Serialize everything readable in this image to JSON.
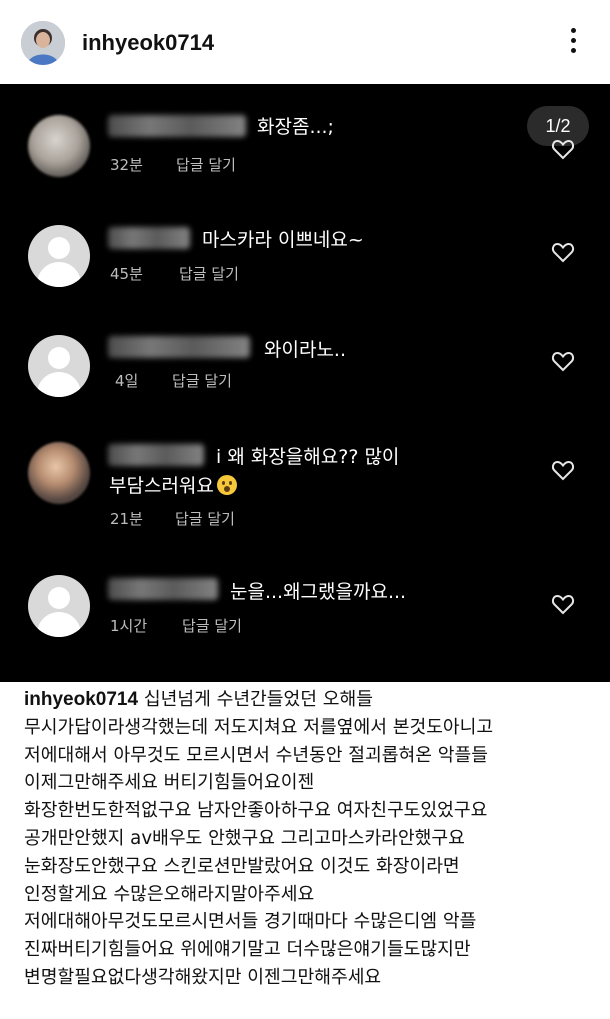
{
  "header": {
    "username": "inhyeok0714",
    "more_icon": "more-vertical-icon"
  },
  "media": {
    "counter": "1/2",
    "comments": [
      {
        "text": "화장좀...;",
        "time": "32분",
        "reply": "답글 달기",
        "avatar": "blurred-photo"
      },
      {
        "text": "마스카라 이쁘네요~",
        "time": "45분",
        "reply": "답글 달기",
        "avatar": "default"
      },
      {
        "text": "와이라노..",
        "time": "4일",
        "reply": "답글 달기",
        "avatar": "default"
      },
      {
        "text_line1": "i 왜 화장을해요?? 많이",
        "text_line2": "부담스러워요",
        "time": "21분",
        "reply": "답글 달기",
        "avatar": "blurred-photo",
        "emoji": "astonished-face"
      },
      {
        "text": "눈을...왜그랬을까요...",
        "time": "1시간",
        "reply": "답글 달기",
        "avatar": "default"
      }
    ]
  },
  "caption": {
    "username": "inhyeok0714",
    "lines": [
      "십년넘게 수년간들었던 오해들",
      "무시가답이라생각했는데 저도지쳐요 저를옆에서 본것도아니고",
      "저에대해서 아무것도 모르시면서 수년동안 절괴롭혀온 악플들",
      "이제그만해주세요 버티기힘들어요이젠",
      "화장한번도한적없구요 남자안좋아하구요 여자친구도있었구요",
      "공개만안했지 av배우도 안했구요 그리고마스카라안했구요",
      "눈화장도안했구요 스킨로션만발랐어요 이것도 화장이라면",
      "인정할게요 수많은오해라지말아주세요",
      "저에대해아무것도모르시면서들 경기때마다 수많은디엠 악플",
      "진짜버티기힘들어요 위에얘기말고 더수많은얘기들도많지만",
      "변명할필요없다생각해왔지만 이젠그만해주세요"
    ]
  }
}
